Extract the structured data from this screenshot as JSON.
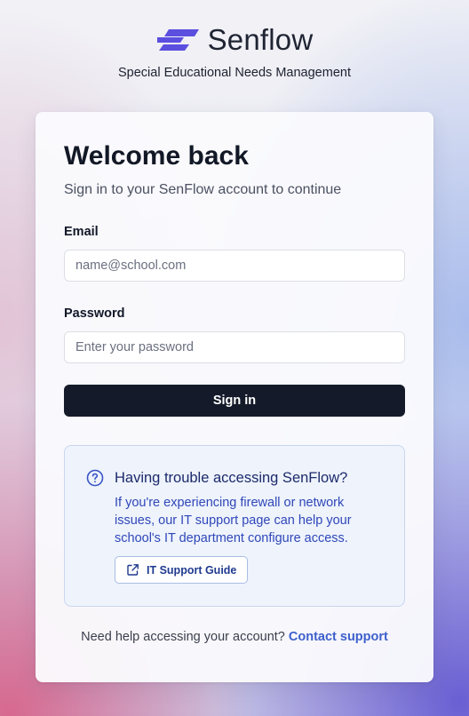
{
  "brand": {
    "name": "Senflow",
    "tagline": "Special Educational Needs Management",
    "accent": "#5b4fe0"
  },
  "card": {
    "title": "Welcome back",
    "subtitle": "Sign in to your SenFlow account to continue"
  },
  "form": {
    "email_label": "Email",
    "email_placeholder": "name@school.com",
    "email_value": "",
    "password_label": "Password",
    "password_placeholder": "Enter your password",
    "password_value": "",
    "submit_label": "Sign in"
  },
  "help": {
    "icon": "question-circle-icon",
    "title": "Having trouble accessing SenFlow?",
    "body": "If you're experiencing firewall or network issues, our IT support page can help your school's IT department configure access.",
    "button_icon": "external-link-icon",
    "button_label": "IT Support Guide"
  },
  "footer": {
    "text": "Need help accessing your account?",
    "link_label": "Contact support"
  },
  "colors": {
    "primary_button": "#141a2a",
    "help_background": "#eef3fc",
    "help_text": "#2f47b8",
    "link": "#3c5fcc"
  }
}
